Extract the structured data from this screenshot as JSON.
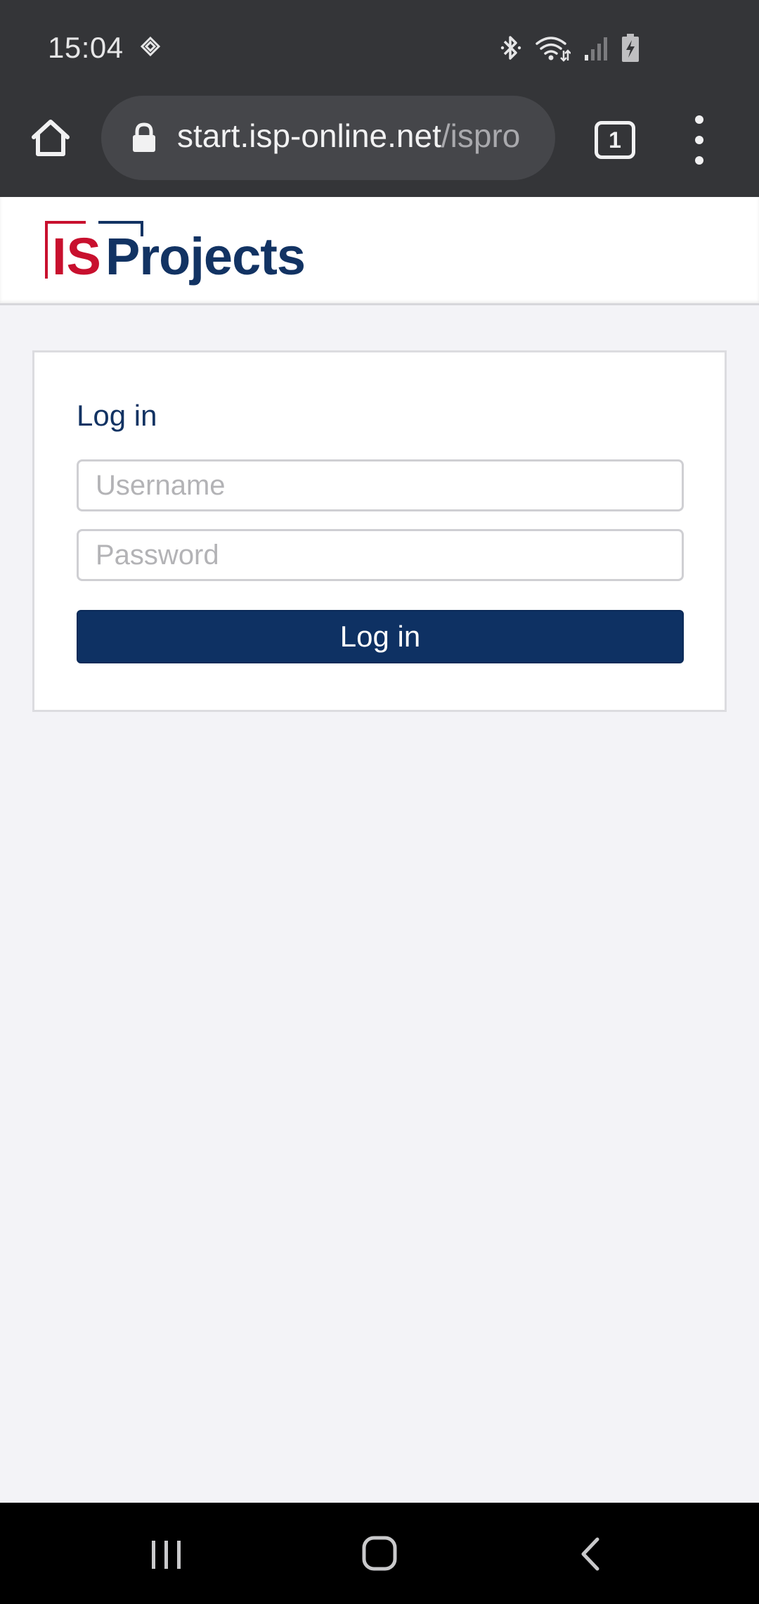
{
  "status_bar": {
    "time": "15:04",
    "icons": [
      "sync-icon",
      "bluetooth-icon",
      "wifi-icon",
      "signal-icon",
      "battery-charging-icon"
    ]
  },
  "browser": {
    "url_host": "start.isp-online.net",
    "url_path": "/ispro",
    "tab_count": "1",
    "icons": [
      "home-icon",
      "lock-icon",
      "tabs-icon",
      "overflow-menu-icon"
    ]
  },
  "site": {
    "logo_text_is": "IS",
    "logo_text_projects": "Projects",
    "logo_colors": {
      "red": "#c8102e",
      "navy": "#123363"
    }
  },
  "login": {
    "title": "Log in",
    "username_placeholder": "Username",
    "password_placeholder": "Password",
    "submit_label": "Log in",
    "button_color": "#0e3163"
  },
  "navigation_bar": {
    "icons": [
      "recents-icon",
      "home-nav-icon",
      "back-icon"
    ]
  }
}
